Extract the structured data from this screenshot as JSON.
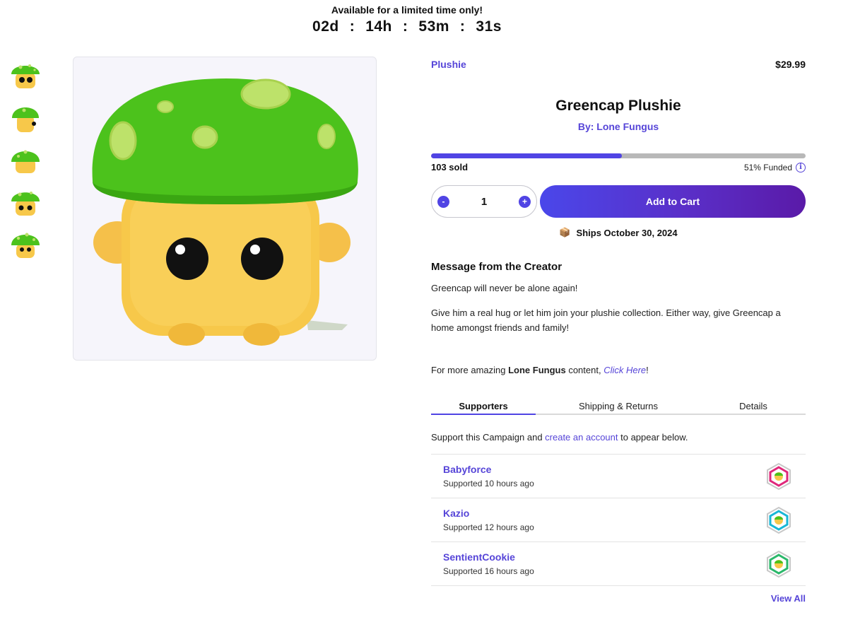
{
  "promo": {
    "headline": "Available for a limited time only!",
    "days": "02d",
    "hours": "14h",
    "minutes": "53m",
    "seconds": "31s",
    "separator": ":"
  },
  "gallery": {
    "thumbnails": [
      "thumb-front",
      "thumb-side",
      "thumb-back",
      "thumb-angle",
      "thumb-top"
    ],
    "main_image": "greencap-plushie-image"
  },
  "product": {
    "category": "Plushie",
    "price": "$29.99",
    "title": "Greencap Plushie",
    "byline": "By: Lone Fungus",
    "funded_fraction": 0.51,
    "sold_label": "103 sold",
    "funded_label": "51% Funded",
    "info_glyph": "i",
    "ships_label": "Ships October 30, 2024",
    "ships_icon": "📦"
  },
  "cart": {
    "decrement": "-",
    "increment": "+",
    "quantity": "1",
    "add_label": "Add to Cart"
  },
  "message": {
    "title": "Message from the Creator",
    "para1": "Greencap will never be alone again!",
    "para2": "Give him a real hug or let him join your plushie collection. Either way, give Greencap a home amongst friends and family!",
    "more_prefix": "For more amazing ",
    "more_strong": "Lone Fungus",
    "more_mid": " content, ",
    "more_link": "Click Here",
    "more_suffix": "!"
  },
  "tabs": [
    {
      "label": "Supporters"
    },
    {
      "label": "Shipping & Returns"
    },
    {
      "label": "Details"
    }
  ],
  "support": {
    "note_prefix": "Support this Campaign and ",
    "note_link": "create an account",
    "note_suffix": " to appear below.",
    "view_all": "View All",
    "list": [
      {
        "name": "Babyforce",
        "when": "Supported 10 hours ago",
        "badge_color": "#e0287a"
      },
      {
        "name": "Kazio",
        "when": "Supported 12 hours ago",
        "badge_color": "#18b7d6"
      },
      {
        "name": "SentientCookie",
        "when": "Supported 16 hours ago",
        "badge_color": "#2bb86a"
      }
    ]
  },
  "colors": {
    "accent": "#5044e4",
    "link": "#5645d8",
    "cap_green": "#4cc21c",
    "body_yellow": "#f7c84a"
  }
}
